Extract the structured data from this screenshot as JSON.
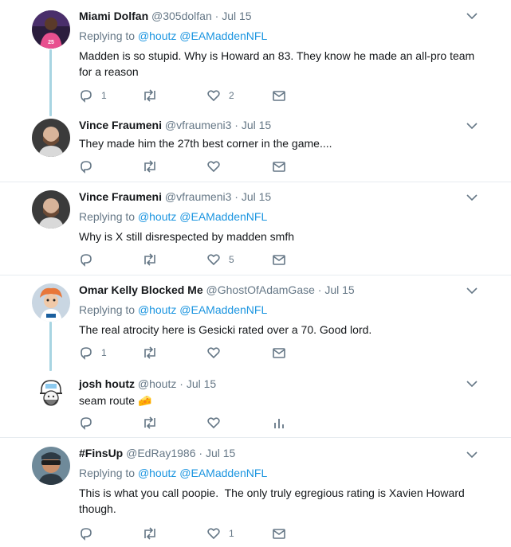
{
  "tweets": [
    {
      "name": "Miami Dolfan",
      "handle": "@305dolfan",
      "separator": "·",
      "time": "Jul 15",
      "replying_prefix": "Replying to",
      "replying_to": [
        "@houtz",
        "@EAMaddenNFL"
      ],
      "text": "Madden is so stupid. Why is Howard an 83. They know he made an all-pro team for a reason",
      "reply_count": "1",
      "retweet_count": "",
      "like_count": "2",
      "avatar_color": "#c9356f"
    },
    {
      "name": "Vince Fraumeni",
      "handle": "@vfraumeni3",
      "separator": "·",
      "time": "Jul 15",
      "text": "They made him the 27th best corner in the game....",
      "reply_count": "",
      "retweet_count": "",
      "like_count": "",
      "avatar_color": "#8a6b55"
    },
    {
      "name": "Vince Fraumeni",
      "handle": "@vfraumeni3",
      "separator": "·",
      "time": "Jul 15",
      "replying_prefix": "Replying to",
      "replying_to": [
        "@houtz",
        "@EAMaddenNFL"
      ],
      "text": "Why is X still disrespected by madden smfh",
      "reply_count": "",
      "retweet_count": "",
      "like_count": "5",
      "avatar_color": "#8a6b55"
    },
    {
      "name": "Omar Kelly Blocked Me",
      "handle": "@GhostOfAdamGase",
      "separator": "·",
      "time": "Jul 15",
      "replying_prefix": "Replying to",
      "replying_to": [
        "@houtz",
        "@EAMaddenNFL"
      ],
      "text": "The real atrocity here is Gesicki rated over a 70. Good lord.",
      "reply_count": "1",
      "retweet_count": "",
      "like_count": "",
      "avatar_color": "#e8773a"
    },
    {
      "name": "josh houtz",
      "handle": "@houtz",
      "separator": "·",
      "time": "Jul 15",
      "text": "seam route",
      "emoji": "🧀",
      "reply_count": "",
      "retweet_count": "",
      "like_count": "",
      "avatar_color": "#cfcfcf"
    },
    {
      "name": "#FinsUp",
      "handle": "@EdRay1986",
      "separator": "·",
      "time": "Jul 15",
      "replying_prefix": "Replying to",
      "replying_to": [
        "@houtz",
        "@EAMaddenNFL"
      ],
      "text": "This is what you call poopie.  The only truly egregious rating is Xavien Howard though.",
      "reply_count": "",
      "retweet_count": "",
      "like_count": "1",
      "avatar_color": "#3a6f8f"
    }
  ],
  "colors": {
    "accent": "#1b95e0",
    "secondary_text": "#657786",
    "thread_line": "#a8d5e2",
    "divider": "#e6ecf0"
  },
  "icons": [
    "reply-icon",
    "retweet-icon",
    "like-icon",
    "direct-message-icon",
    "analytics-icon",
    "chevron-down-icon"
  ]
}
